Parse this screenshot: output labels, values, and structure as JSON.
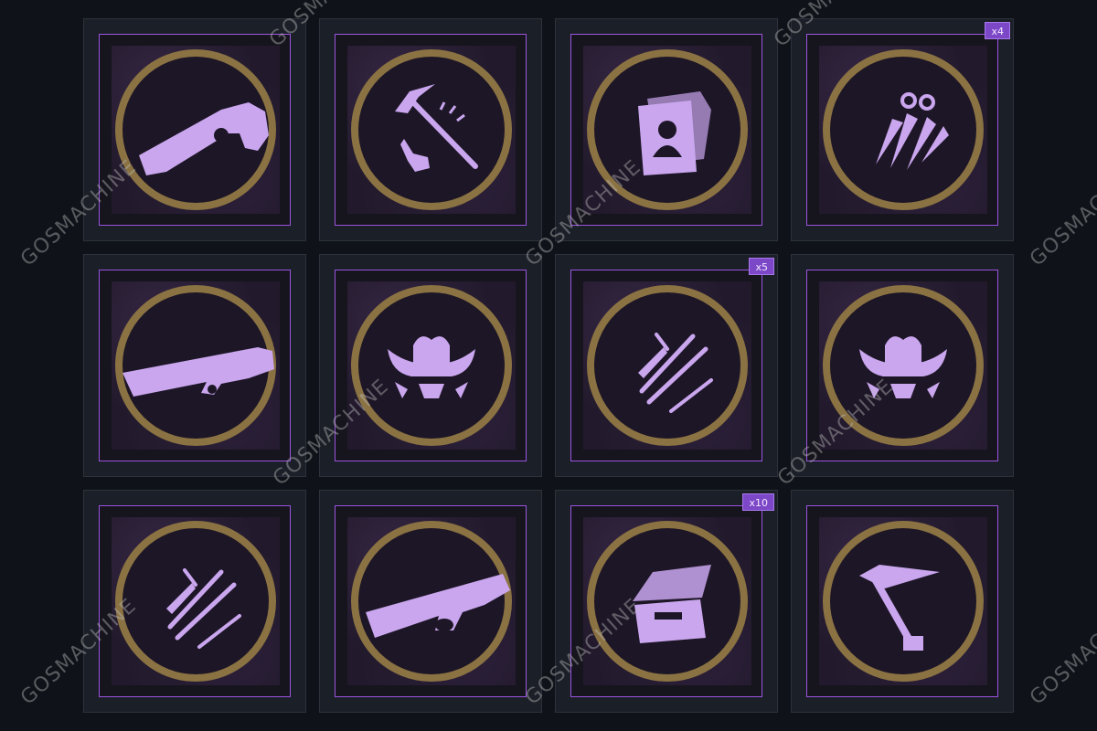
{
  "colors": {
    "background": "#0f1319",
    "tile_bg": "#1b1f27",
    "frame_border": "#9b54e0",
    "ring": "#8a7243",
    "icon": "#c9a6ee",
    "badge_bg": "#7d48c8"
  },
  "watermark": "GOSMACHINE",
  "items": [
    {
      "icon": "revolver-icon",
      "badge": ""
    },
    {
      "icon": "pickaxe-hand-icon",
      "badge": ""
    },
    {
      "icon": "wanted-posters-icon",
      "badge": ""
    },
    {
      "icon": "arrowheads-icon",
      "badge": "x4"
    },
    {
      "icon": "rifle-icon",
      "badge": ""
    },
    {
      "icon": "cowboy-hunter-icon",
      "badge": ""
    },
    {
      "icon": "weapon-bundle-icon",
      "badge": "x5"
    },
    {
      "icon": "cowboy-hunter-icon",
      "badge": ""
    },
    {
      "icon": "weapon-bundle-icon",
      "badge": ""
    },
    {
      "icon": "lever-action-rifle-icon",
      "badge": ""
    },
    {
      "icon": "ammo-crate-icon",
      "badge": "x10"
    },
    {
      "icon": "hammer-icon",
      "badge": ""
    }
  ]
}
